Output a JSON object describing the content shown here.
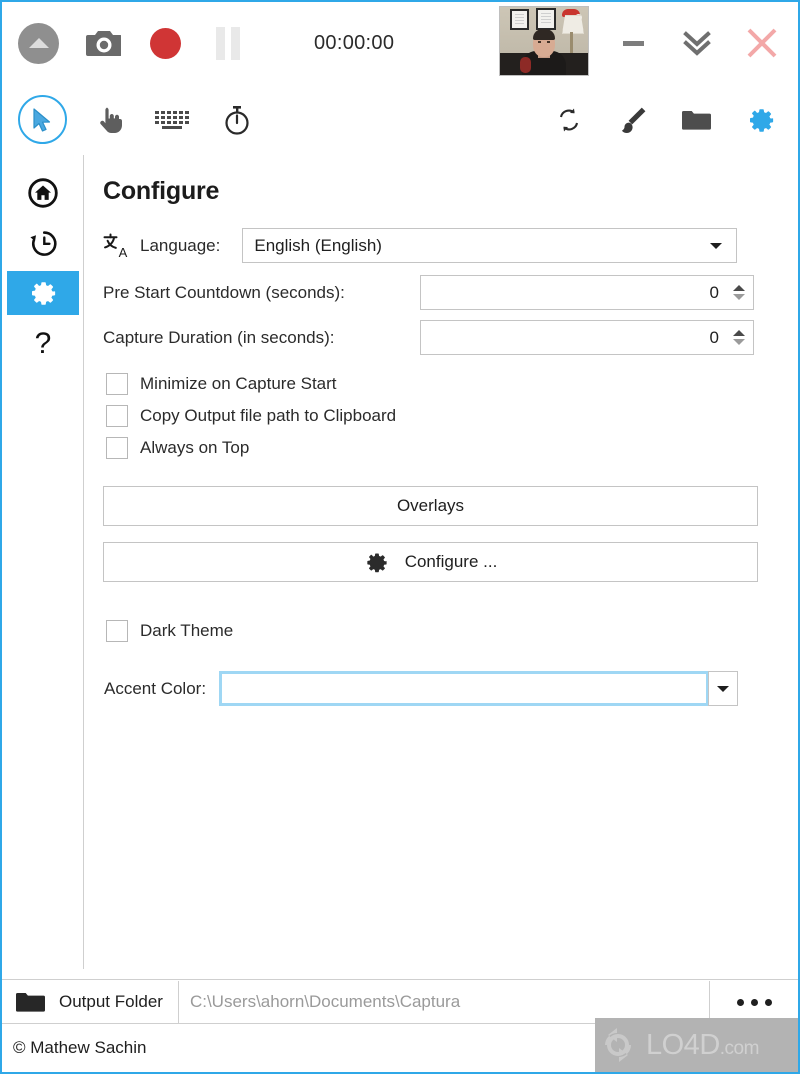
{
  "app": {
    "accent_color": "#2fa8e8",
    "title_bar": {
      "timer": "00:00:00",
      "buttons": [
        {
          "name": "up-arrow-circle",
          "icon": "up-arrow-circle-icon"
        },
        {
          "name": "screenshot",
          "icon": "camera-icon"
        },
        {
          "name": "record",
          "icon": "record-dot-icon"
        },
        {
          "name": "pause",
          "icon": "pause-icon"
        }
      ],
      "webcam_preview_label": "Webcam Preview",
      "minimize_label": "Minimize",
      "collapse_label": "Collapse",
      "close_label": "Close"
    },
    "toolbar": {
      "left": [
        {
          "name": "cursor",
          "icon": "mouse-pointer-icon",
          "selected": true
        },
        {
          "name": "clicks",
          "icon": "hand-pointing-icon",
          "selected": false
        },
        {
          "name": "keystrokes",
          "icon": "keyboard-icon",
          "selected": false
        },
        {
          "name": "elapsed",
          "icon": "stopwatch-icon",
          "selected": false
        }
      ],
      "right": [
        {
          "name": "refresh",
          "icon": "refresh-icon"
        },
        {
          "name": "brush",
          "icon": "paint-brush-icon"
        },
        {
          "name": "folder",
          "icon": "folder-icon"
        },
        {
          "name": "settings",
          "icon": "gear-icon",
          "active": true
        }
      ]
    },
    "sidebar": {
      "items": [
        {
          "name": "home",
          "icon": "home-icon",
          "selected": false
        },
        {
          "name": "history",
          "icon": "history-clock-icon",
          "selected": false
        },
        {
          "name": "settings",
          "icon": "gear-icon",
          "selected": true
        },
        {
          "name": "help",
          "icon": "question-mark-icon",
          "selected": false
        }
      ]
    }
  },
  "configure": {
    "heading": "Configure",
    "language": {
      "icon": "translate-icon",
      "label": "Language:",
      "value": "English (English)"
    },
    "pre_start_countdown": {
      "label": "Pre Start Countdown (seconds):",
      "value": "0"
    },
    "capture_duration": {
      "label": "Capture Duration (in seconds):",
      "value": "0"
    },
    "checkboxes": [
      {
        "label": "Minimize on Capture Start",
        "checked": false
      },
      {
        "label": "Copy Output file path to Clipboard",
        "checked": false
      },
      {
        "label": "Always on Top",
        "checked": false
      }
    ],
    "overlays_button": "Overlays",
    "configure_button": "Configure ...",
    "dark_theme": {
      "label": "Dark Theme",
      "checked": false
    },
    "accent_color": {
      "label": "Accent Color:",
      "value": "#2196d9"
    }
  },
  "output_bar": {
    "folder_icon": "folder-icon",
    "folder_label": "Output Folder",
    "path": "C:\\Users\\ahorn\\Documents\\Captura",
    "more_label": "..."
  },
  "status_bar": {
    "copyright": "© Mathew Sachin"
  },
  "watermark": {
    "text": "LO4D",
    "suffix": ".com"
  }
}
